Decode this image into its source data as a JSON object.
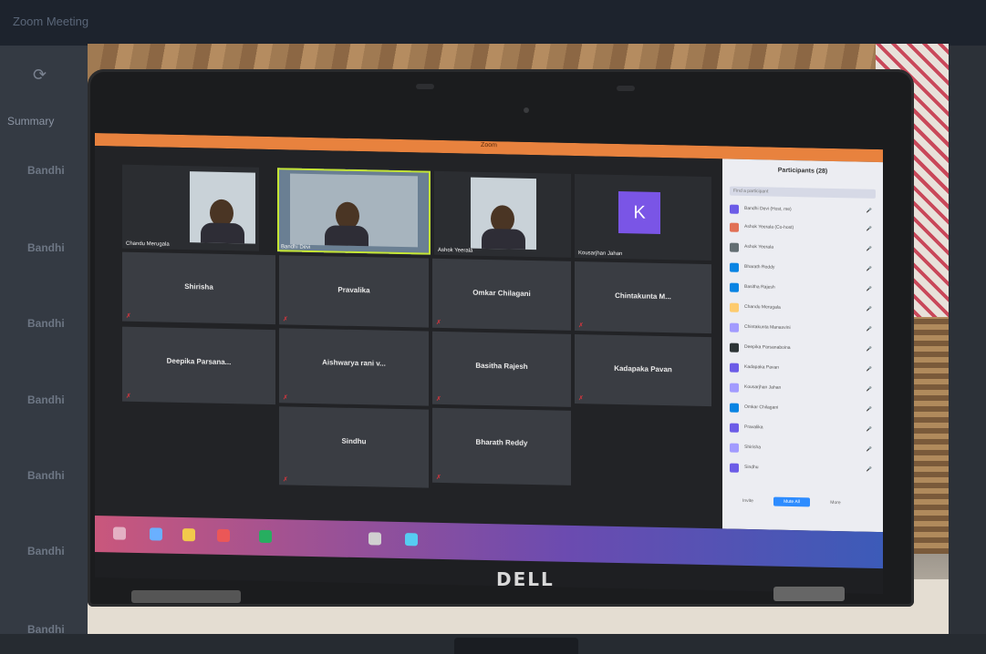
{
  "background_app": {
    "title": "Zoom Meeting",
    "tab": "Summary",
    "rows": [
      "Bandhi",
      "Bandhi",
      "Bandhi",
      "Bandhi",
      "Bandhi",
      "Bandhi",
      "Bandhi"
    ]
  },
  "photo": {
    "brand": "DELL",
    "window_title": "Zoom",
    "video_tiles": [
      {
        "name": "Chandu Merugala",
        "video": true
      },
      {
        "name": "Bandhi Devi",
        "video": true,
        "speaking": true
      },
      {
        "name": "Ashok Yeerala",
        "video": true
      },
      {
        "name": "Kousarjhan Jahan",
        "avatar_letter": "K"
      }
    ],
    "name_tiles": [
      "Shirisha",
      "Pravalika",
      "Omkar Chilagani",
      "Chintakunta M...",
      "Deepika Parsana...",
      "Aishwarya rani v...",
      "Basitha Rajesh",
      "Kadapaka Pavan",
      "Sindhu",
      "Bharath Reddy"
    ],
    "participants_panel": {
      "title": "Participants (28)",
      "search_placeholder": "Find a participant",
      "participants": [
        {
          "name": "Bandhi Devi (Host, me)",
          "color": "#6c5ce7"
        },
        {
          "name": "Ashok Yeerala (Co-host)",
          "color": "#e17055"
        },
        {
          "name": "Ashok Yeerala",
          "color": "#636e72"
        },
        {
          "name": "Bharath Reddy",
          "color": "#0984e3"
        },
        {
          "name": "Basitha Rajesh",
          "color": "#0984e3"
        },
        {
          "name": "Chandu Merugala",
          "color": "#fdcb6e"
        },
        {
          "name": "Chintakunta Manasvini",
          "color": "#a29bfe"
        },
        {
          "name": "Deepika Parsanaboina",
          "color": "#2d3436"
        },
        {
          "name": "Kadapaka Pavan",
          "color": "#6c5ce7"
        },
        {
          "name": "Kousarjhan Jahan",
          "color": "#a29bfe"
        },
        {
          "name": "Omkar Chilagani",
          "color": "#0984e3"
        },
        {
          "name": "Pravalika",
          "color": "#6c5ce7"
        },
        {
          "name": "Shirisha",
          "color": "#a29bfe"
        },
        {
          "name": "Sindhu",
          "color": "#6c5ce7"
        }
      ],
      "buttons": [
        "Invite",
        "Mute All",
        "More"
      ]
    }
  }
}
